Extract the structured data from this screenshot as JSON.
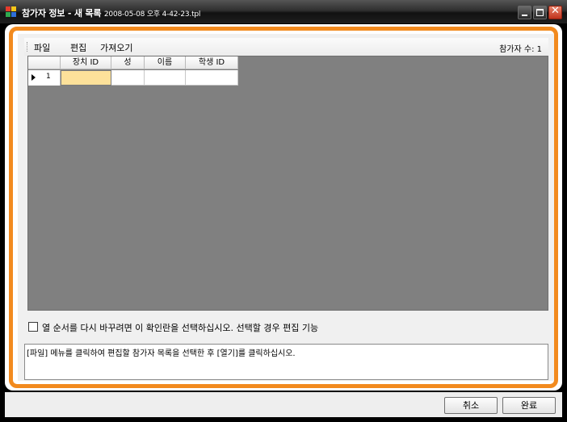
{
  "window": {
    "title": "참가자 정보 - 새 목록",
    "filename": "2008-05-08 오후 4-42-23.tpl",
    "icon_colors": [
      "#e53b2c",
      "#f5c518",
      "#2fa84f",
      "#2f6fd8"
    ],
    "close_symbol": "✕"
  },
  "menu": {
    "file": "파일",
    "edit": "편집",
    "import": "가져오기"
  },
  "participant_count": "참가자 수: 1",
  "grid": {
    "columns": [
      "장치 ID",
      "성",
      "이름",
      "학생 ID"
    ],
    "rows": [
      {
        "number": "1",
        "device_id": "",
        "last_name": "",
        "first_name": "",
        "student_id": ""
      }
    ]
  },
  "reorder_checkbox": {
    "checked": false,
    "label": "열 순서를 다시 바꾸려면 이 확인란을 선택하십시오. 선택할 경우 편집 기능"
  },
  "info_text": "[파일] 메뉴를 클릭하여 편집할 참가자 목록을 선택한 후 [열기]를 클릭하십시오.",
  "buttons": {
    "cancel": "취소",
    "done": "완료"
  },
  "colors": {
    "frame_accent": "#f28a1e",
    "grid_background": "#808080",
    "active_cell": "#fde19a",
    "close_button": "#d24a30"
  }
}
